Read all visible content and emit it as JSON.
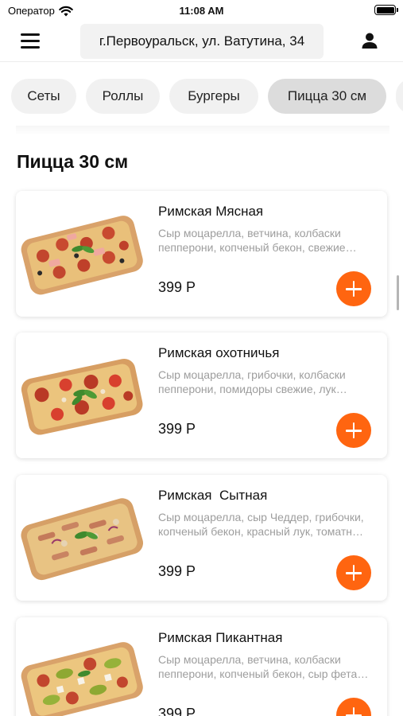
{
  "status_bar": {
    "carrier": "Оператор",
    "time": "11:08 AM"
  },
  "header": {
    "address": "г.Первоуральск, ул. Ватутина, 34"
  },
  "tabs": [
    {
      "label": "Сеты"
    },
    {
      "label": "Роллы"
    },
    {
      "label": "Бургеры"
    },
    {
      "label": "Пицца 30 см",
      "active": true
    },
    {
      "label": ""
    }
  ],
  "section": {
    "title": "Пицца 30 см"
  },
  "products": [
    {
      "name": "Римская Мясная",
      "description": "Сыр моцарелла, ветчина, колбаски пепперони, копченый бекон, свежие шампиньоны, томатный соус",
      "price": "399 Р"
    },
    {
      "name": "Римская охотничья",
      "description": "Сыр моцарелла, грибочки, колбаски пепперони, помидоры свежие, лук красный, томатный соус",
      "price": "399 Р"
    },
    {
      "name": "Римская  Сытная",
      "description": "Сыр моцарелла, сыр Чеддер, грибочки, копченый бекон, красный лук, томатный соус",
      "price": "399 Р"
    },
    {
      "name": "Римская Пикантная",
      "description": "Сыр моцарелла, ветчина, колбаски пепперони, копченый бекон, сыр фета, маринованные огурчики",
      "price": "399 Р"
    }
  ],
  "colors": {
    "accent": "#ff6510",
    "tab_active": "#dcdcdc",
    "tab_bg": "#f1f1f1",
    "muted_text": "#9d9d9d"
  },
  "icons": {
    "menu": "hamburger-menu-icon",
    "profile": "user-icon",
    "add": "plus-icon",
    "wifi": "wifi-icon",
    "battery": "battery-icon"
  }
}
